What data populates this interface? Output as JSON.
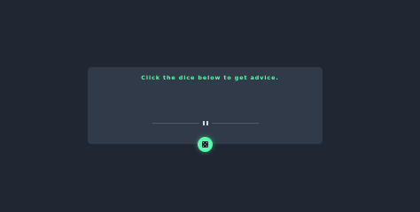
{
  "card": {
    "prompt": "Click the dice below to get advice."
  },
  "divider": {
    "icon": "pause-icon"
  },
  "dice_button": {
    "icon": "dice-icon"
  },
  "colors": {
    "background": "#202632",
    "card": "#313a49",
    "accent": "#53ffaa",
    "divider_line": "#4f5b6c",
    "divider_icon": "#cee3e9"
  }
}
